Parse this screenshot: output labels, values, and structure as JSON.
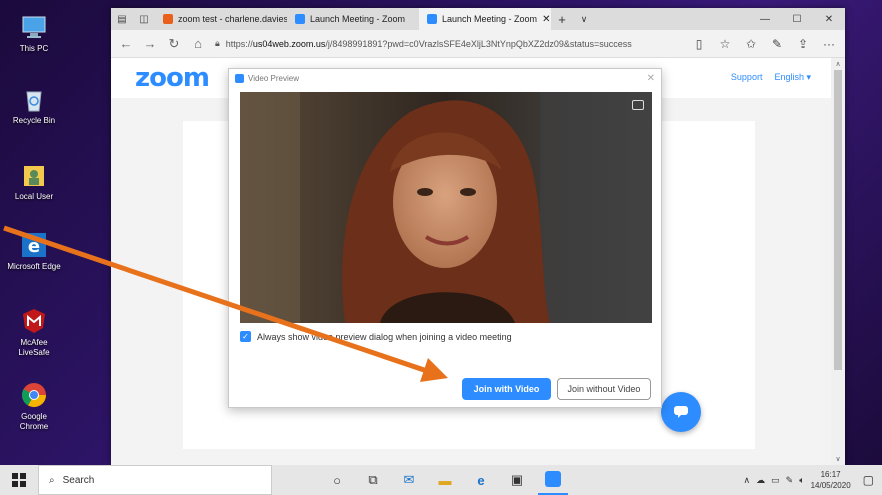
{
  "desktop": {
    "icons": [
      {
        "label": "This PC",
        "icon": "this-pc-icon"
      },
      {
        "label": "Recycle Bin",
        "icon": "recycle-bin-icon"
      },
      {
        "label": "Local User",
        "icon": "local-user-folder-icon"
      },
      {
        "label": "Microsoft Edge",
        "icon": "edge-icon"
      },
      {
        "label": "McAfee LiveSafe",
        "icon": "mcafee-icon"
      },
      {
        "label": "Google Chrome",
        "icon": "chrome-icon"
      }
    ]
  },
  "browser": {
    "tabs": [
      {
        "label": "zoom test - charlene.davies"
      },
      {
        "label": "Launch Meeting - Zoom"
      },
      {
        "label": "Launch Meeting - Zoom"
      }
    ],
    "url": {
      "prefix": "https://",
      "host": "us04web.zoom.us",
      "path": "/j/8498991891?pwd=c0VrazlsSFE4eXljL3NtYnpQbXZ2dz09&status=success"
    },
    "page": {
      "support": "Support",
      "language": "English ▾"
    }
  },
  "dialog": {
    "title": "Video Preview",
    "checkbox_label": "Always show video preview dialog when joining a video meeting",
    "join_with_video": "Join with Video",
    "join_without_video": "Join without Video"
  },
  "taskbar": {
    "search_placeholder": "Search",
    "time": "16:17",
    "date": "14/05/2020"
  },
  "colors": {
    "zoom_blue": "#2d8cff",
    "annotation_arrow": "#e8721c"
  }
}
